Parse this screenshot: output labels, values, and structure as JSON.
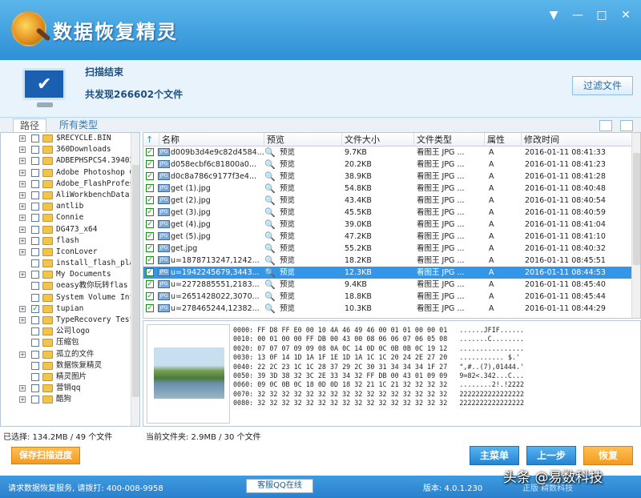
{
  "app": {
    "title": "数据恢复精灵"
  },
  "window_buttons": [
    "▼",
    "—",
    "□",
    "✕"
  ],
  "status": {
    "title": "扫描结束",
    "count_text": "共发现266602个文件",
    "filter_button": "过滤文件"
  },
  "tabs": [
    "路径",
    "所有类型"
  ],
  "tree": [
    {
      "label": "$RECYCLE.BIN",
      "expand": "+",
      "checked": false
    },
    {
      "label": "360Downloads",
      "expand": "+",
      "checked": false
    },
    {
      "label": "ADBEPHSPCS4.39402",
      "expand": "+",
      "checked": false
    },
    {
      "label": "Adobe Photoshop C",
      "expand": "+",
      "checked": false
    },
    {
      "label": "Adobe_FlashProfes",
      "expand": "+",
      "checked": false
    },
    {
      "label": "AliWorkbenchData",
      "expand": "+",
      "checked": false
    },
    {
      "label": "antlib",
      "expand": "+",
      "checked": false
    },
    {
      "label": "Connie",
      "expand": "+",
      "checked": false
    },
    {
      "label": "DG473_x64",
      "expand": "+",
      "checked": false
    },
    {
      "label": "flash",
      "expand": "+",
      "checked": false
    },
    {
      "label": "IconLover",
      "expand": "+",
      "checked": false
    },
    {
      "label": "install_flash_pla",
      "expand": "",
      "checked": false
    },
    {
      "label": "My Documents",
      "expand": "+",
      "checked": false
    },
    {
      "label": "oeasy教你玩转flas",
      "expand": "",
      "checked": false
    },
    {
      "label": "System Volume Inf",
      "expand": "",
      "checked": false
    },
    {
      "label": "tupian",
      "expand": "+",
      "checked": true
    },
    {
      "label": "TypeRecovery Test",
      "expand": "+",
      "checked": false
    },
    {
      "label": "公司logo",
      "expand": "",
      "checked": false
    },
    {
      "label": "压缩包",
      "expand": "",
      "checked": false
    },
    {
      "label": "孤立的文件",
      "expand": "+",
      "checked": false
    },
    {
      "label": "数据恢复精灵",
      "expand": "",
      "checked": false
    },
    {
      "label": "精灵图片",
      "expand": "",
      "checked": false
    },
    {
      "label": "营销qq",
      "expand": "+",
      "checked": false
    },
    {
      "label": "酷狗",
      "expand": "+",
      "checked": false
    }
  ],
  "list": {
    "headers": [
      "名称",
      "预览",
      "文件大小",
      "文件类型",
      "属性",
      "修改时间"
    ],
    "rows": [
      {
        "name": "d009b3d4e9c82d4584...",
        "preview": "预览",
        "size": "9.7KB",
        "type": "看图王 JPG ...",
        "attr": "A",
        "time": "2016-01-11 08:41:33"
      },
      {
        "name": "d058ecbf6c81800a0...",
        "preview": "预览",
        "size": "20.2KB",
        "type": "看图王 JPG ...",
        "attr": "A",
        "time": "2016-01-11 08:41:23"
      },
      {
        "name": "d0c8a786c9177f3e4...",
        "preview": "预览",
        "size": "38.9KB",
        "type": "看图王 JPG ...",
        "attr": "A",
        "time": "2016-01-11 08:41:28"
      },
      {
        "name": "get (1).jpg",
        "preview": "预览",
        "size": "54.8KB",
        "type": "看图王 JPG ...",
        "attr": "A",
        "time": "2016-01-11 08:40:48"
      },
      {
        "name": "get (2).jpg",
        "preview": "预览",
        "size": "43.4KB",
        "type": "看图王 JPG ...",
        "attr": "A",
        "time": "2016-01-11 08:40:54"
      },
      {
        "name": "get (3).jpg",
        "preview": "预览",
        "size": "45.5KB",
        "type": "看图王 JPG ...",
        "attr": "A",
        "time": "2016-01-11 08:40:59"
      },
      {
        "name": "get (4).jpg",
        "preview": "预览",
        "size": "39.0KB",
        "type": "看图王 JPG ...",
        "attr": "A",
        "time": "2016-01-11 08:41:04"
      },
      {
        "name": "get (5).jpg",
        "preview": "预览",
        "size": "47.2KB",
        "type": "看图王 JPG ...",
        "attr": "A",
        "time": "2016-01-11 08:41:10"
      },
      {
        "name": "get.jpg",
        "preview": "预览",
        "size": "55.2KB",
        "type": "看图王 JPG ...",
        "attr": "A",
        "time": "2016-01-11 08:40:32"
      },
      {
        "name": "u=1878713247,1242...",
        "preview": "预览",
        "size": "18.2KB",
        "type": "看图王 JPG ...",
        "attr": "A",
        "time": "2016-01-11 08:45:51"
      },
      {
        "name": "u=1942245679,3443...",
        "preview": "预览",
        "size": "12.3KB",
        "type": "看图王 JPG ...",
        "attr": "A",
        "time": "2016-01-11 08:44:53",
        "selected": true
      },
      {
        "name": "u=2272885551,2183...",
        "preview": "预览",
        "size": "9.4KB",
        "type": "看图王 JPG ...",
        "attr": "A",
        "time": "2016-01-11 08:45:40"
      },
      {
        "name": "u=2651428022,3070...",
        "preview": "预览",
        "size": "18.8KB",
        "type": "看图王 JPG ...",
        "attr": "A",
        "time": "2016-01-11 08:45:44"
      },
      {
        "name": "u=278465244,12382...",
        "preview": "预览",
        "size": "10.3KB",
        "type": "看图王 JPG ...",
        "attr": "A",
        "time": "2016-01-11 08:44:29"
      }
    ]
  },
  "hex_dump": "0000: FF D8 FF E0 00 10 4A 46 49 46 00 01 01 00 00 01   ......JFIF......\n0010: 00 01 00 00 FF DB 00 43 00 08 06 06 07 06 05 08   .......C........\n0020: 07 07 07 09 09 08 0A 0C 14 0D 0C 0B 0B 0C 19 12   ................\n0030: 13 0F 14 1D 1A 1F 1E 1D 1A 1C 1C 20 24 2E 27 20   ........... $.'\n0040: 22 2C 23 1C 1C 28 37 29 2C 30 31 34 34 34 1F 27   \",#..(7),01444.'\n0050: 39 3D 38 32 3C 2E 33 34 32 FF DB 00 43 01 09 09   9=82<.342...C...\n0060: 09 0C 0B 0C 18 0D 0D 18 32 21 1C 21 32 32 32 32   ........2!.!2222\n0070: 32 32 32 32 32 32 32 32 32 32 32 32 32 32 32 32   2222222222222222\n0080: 32 32 32 32 32 32 32 32 32 32 32 32 32 32 32 32   2222222222222222",
  "footer": {
    "selected": "已选择: 134.2MB / 49 个文件",
    "current_folder": "当前文件夹: 2.9MB / 30 个文件",
    "save_button": "保存扫描进度",
    "main_menu_button": "主菜单",
    "prev_button": "上一步",
    "recover_button": "恢复"
  },
  "bottom": {
    "service": "请求数据恢复服务, 请拨打: 400-008-9958",
    "qq_button": "客服QQ在线",
    "version": "版本: 4.0.1.230",
    "partial": "正版  精数科技",
    "watermark": "头条 @易数科技"
  },
  "colors": {
    "title_blue": "#2d8fd6",
    "select_blue": "#3396e8",
    "orange": "#f39a1e"
  }
}
